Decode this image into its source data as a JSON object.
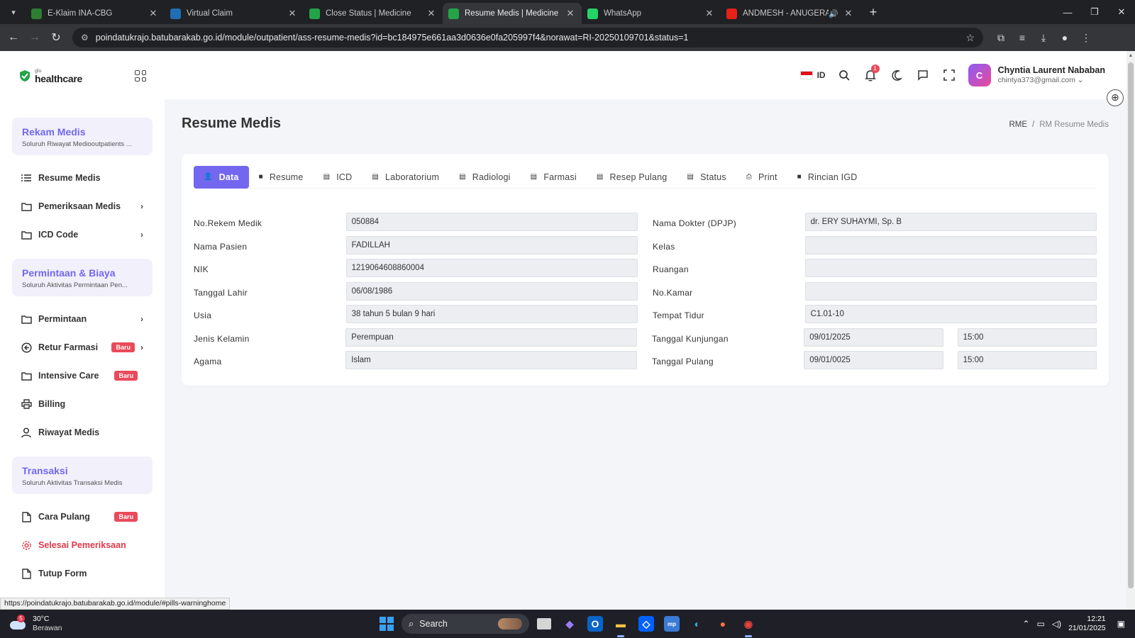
{
  "browser": {
    "tabs": [
      {
        "title": "E-Klaim INA-CBG",
        "favicon": "eklaim-icon",
        "color": "#2e7d32"
      },
      {
        "title": "Virtual Claim",
        "favicon": "virtual-claim-icon",
        "color": "#1f6fb2"
      },
      {
        "title": "Close Status | Medicine",
        "favicon": "medicine-icon",
        "color": "#22a447"
      },
      {
        "title": "Resume Medis | Medicine",
        "favicon": "medicine-icon",
        "color": "#22a447"
      },
      {
        "title": "WhatsApp",
        "favicon": "whatsapp-icon",
        "color": "#25d366"
      },
      {
        "title": "ANDMESH - ANUGERAH TE",
        "favicon": "youtube-icon",
        "color": "#e62117"
      }
    ],
    "active_tab": 3,
    "url": "poindatukrajo.batubarakab.go.id/module/outpatient/ass-resume-medis?id=bc184975e661aa3d0636e0fa205997f4&norawat=RI-20250109701&status=1",
    "status_url": "https://poindatukrajo.batubarakab.go.id/module/#pills-warninghome"
  },
  "brand": {
    "small": "glu",
    "name": "healthcare"
  },
  "sidebar": {
    "sections": [
      {
        "title": "Rekam Medis",
        "subtitle": "Soluruh Riwayat Mediooutpatients ...",
        "items": [
          {
            "label": "Resume Medis",
            "icon": "list-icon",
            "chevron": false,
            "badge": ""
          },
          {
            "label": "Pemeriksaan Medis",
            "icon": "folder-icon",
            "chevron": true,
            "badge": ""
          },
          {
            "label": "ICD Code",
            "icon": "folder-icon",
            "chevron": true,
            "badge": ""
          }
        ]
      },
      {
        "title": "Permintaan & Biaya",
        "subtitle": "Soluruh Aktivitas Permintaan Pen...",
        "items": [
          {
            "label": "Permintaan",
            "icon": "folder-icon",
            "chevron": true,
            "badge": ""
          },
          {
            "label": "Retur Farmasi",
            "icon": "return-icon",
            "chevron": true,
            "badge": "Baru"
          },
          {
            "label": "Intensive Care",
            "icon": "folder-icon",
            "chevron": false,
            "badge": "Baru"
          },
          {
            "label": "Billing",
            "icon": "printer-icon",
            "chevron": false,
            "badge": ""
          },
          {
            "label": "Riwayat Medis",
            "icon": "user-icon",
            "chevron": false,
            "badge": ""
          }
        ]
      },
      {
        "title": "Transaksi",
        "subtitle": "Soluruh Aktivitas Transaksi Medis",
        "items": [
          {
            "label": "Cara Pulang",
            "icon": "file-icon",
            "chevron": false,
            "badge": "Baru"
          },
          {
            "label": "Selesai Pemeriksaan",
            "icon": "gear-icon",
            "chevron": false,
            "badge": "",
            "danger": true
          },
          {
            "label": "Tutup Form",
            "icon": "file-icon",
            "chevron": false,
            "badge": ""
          }
        ]
      }
    ]
  },
  "header": {
    "lang": "ID",
    "notif_count": "1",
    "user_name": "Chyntia Laurent Nababan",
    "user_email": "chintya373@gmail.com"
  },
  "page": {
    "title": "Resume Medis",
    "breadcrumb_root": "RME",
    "breadcrumb_current": "RM Resume Medis"
  },
  "tabs": [
    "Data",
    "Resume",
    "ICD",
    "Laboratorium",
    "Radiologi",
    "Farmasi",
    "Resep Pulang",
    "Status",
    "Print",
    "Rincian IGD"
  ],
  "active_tab": 0,
  "form": {
    "left": [
      {
        "label": "No.Rekem Medik",
        "value": "050884"
      },
      {
        "label": "Nama Pasien",
        "value": "FADILLAH"
      },
      {
        "label": "NIK",
        "value": "1219064608860004"
      },
      {
        "label": "Tanggal Lahir",
        "value": "06/08/1986"
      },
      {
        "label": "Usia",
        "value": "38 tahun 5 bulan 9 hari"
      },
      {
        "label": "Jenis Kelamin",
        "value": "Perempuan"
      },
      {
        "label": "Agama",
        "value": "Islam"
      }
    ],
    "right": [
      {
        "label": "Nama Dokter (DPJP)",
        "value": "dr. ERY SUHAYMI, Sp. B"
      },
      {
        "label": "Kelas",
        "value": ""
      },
      {
        "label": "Ruangan",
        "value": ""
      },
      {
        "label": "No.Kamar",
        "value": ""
      },
      {
        "label": "Tempat Tidur",
        "value": "C1.01-10"
      },
      {
        "label": "Tanggal Kunjungan",
        "value": "09/01/2025",
        "time": "15:00"
      },
      {
        "label": "Tanggal Pulang",
        "value": "09/01/0025",
        "time": "15:00"
      }
    ]
  },
  "taskbar": {
    "temp": "30°C",
    "condition": "Berawan",
    "weather_badge": "5",
    "search": "Search",
    "time": "12:21",
    "date": "21/01/2025"
  },
  "colors": {
    "accent": "#7367f0",
    "danger": "#ea4a5a"
  }
}
